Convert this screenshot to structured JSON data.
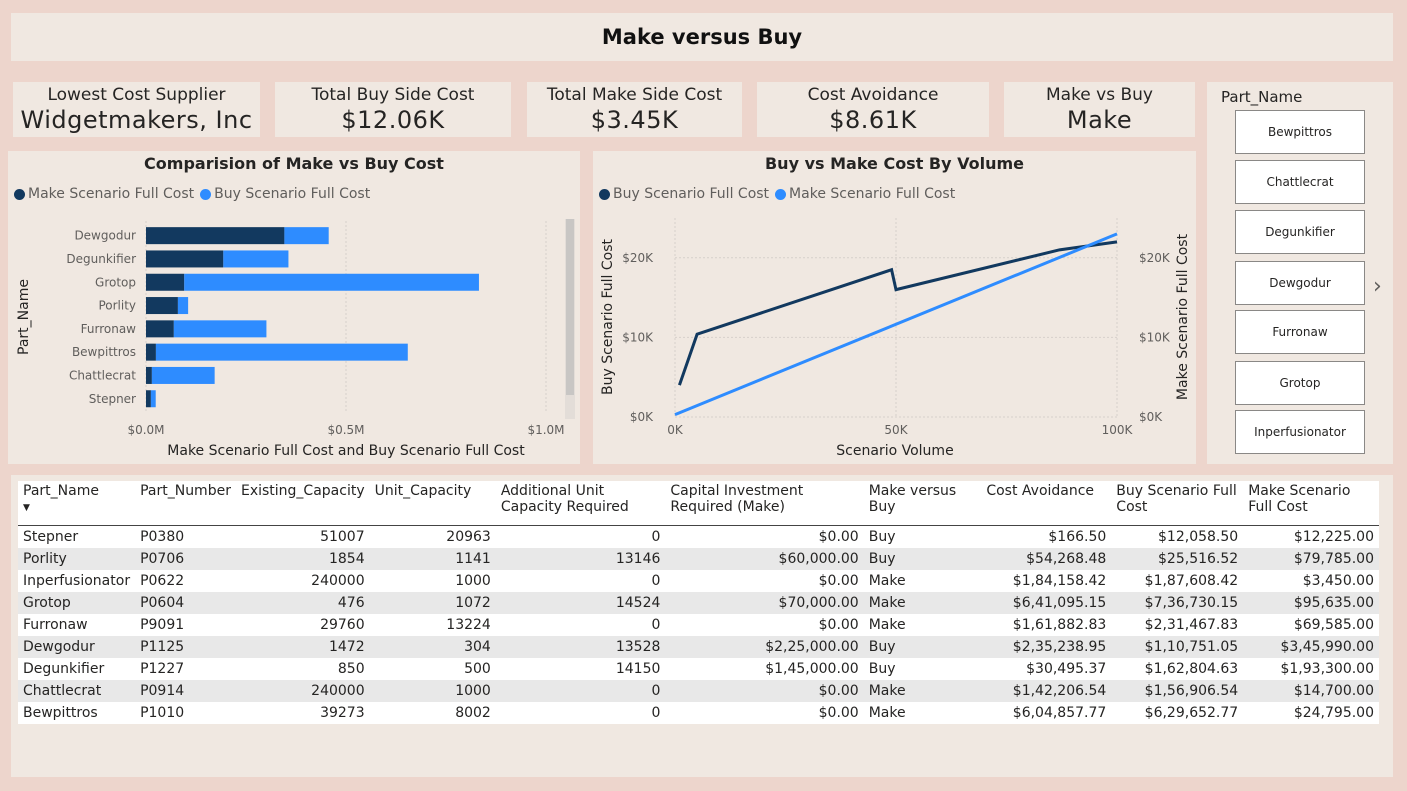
{
  "title": "Make versus Buy",
  "cards": [
    {
      "label": "Lowest Cost Supplier",
      "value": "Widgetmakers, Inc"
    },
    {
      "label": "Total Buy Side Cost",
      "value": "$12.06K"
    },
    {
      "label": "Total Make Side Cost",
      "value": "$3.45K"
    },
    {
      "label": "Cost Avoidance",
      "value": "$8.61K"
    },
    {
      "label": "Make vs Buy",
      "value": "Make"
    }
  ],
  "colors": {
    "make_dark": "#12395F",
    "buy_light": "#2E8CFF",
    "panel": "#F0E8E1",
    "background": "#EDD5CC"
  },
  "chart_data": [
    {
      "type": "bar",
      "title": "Comparision of Make vs Buy Cost",
      "xlabel": "Make Scenario Full Cost and Buy Scenario Full Cost",
      "ylabel": "Part_Name",
      "legend": [
        "Make Scenario Full Cost",
        "Buy Scenario Full Cost"
      ],
      "legend_position": "top-left",
      "stacked": true,
      "categories": [
        "Dewgodur",
        "Degunkifier",
        "Grotop",
        "Porlity",
        "Furronaw",
        "Bewpittros",
        "Chattlecrat",
        "Stepner"
      ],
      "series": [
        {
          "name": "Make Scenario Full Cost",
          "values": [
            345990,
            193300,
            95635,
            79785,
            69585,
            24795,
            14700,
            12225
          ]
        },
        {
          "name": "Buy Scenario Full Cost",
          "values": [
            110751,
            162805,
            736730,
            25517,
            231468,
            629653,
            156907,
            12059
          ]
        }
      ],
      "xlim": [
        0,
        1000000
      ],
      "xticks": [
        "$0.0M",
        "$0.5M",
        "$1.0M"
      ],
      "grid": true
    },
    {
      "type": "line",
      "title": "Buy vs Make Cost By Volume",
      "xlabel": "Scenario Volume",
      "ylabel": "Buy Scenario Full Cost",
      "ylabel_right": "Make Scenario Full Cost",
      "legend": [
        "Buy Scenario Full Cost",
        "Make Scenario Full Cost"
      ],
      "legend_position": "top-left",
      "xticks": [
        "0K",
        "50K",
        "100K"
      ],
      "yticks": [
        "$0K",
        "$10K",
        "$20K"
      ],
      "xlim": [
        0,
        100000
      ],
      "ylim": [
        0,
        25000
      ],
      "grid": true,
      "series": [
        {
          "name": "Buy Scenario Full Cost",
          "x": [
            1000,
            5000,
            49000,
            50000,
            87000,
            100000
          ],
          "y": [
            4000,
            10400,
            18500,
            16000,
            21000,
            22000
          ]
        },
        {
          "name": "Make Scenario Full Cost",
          "x": [
            0,
            100000
          ],
          "y": [
            300,
            23000
          ]
        }
      ]
    }
  ],
  "slicer": {
    "title": "Part_Name",
    "items": [
      "Bewpittros",
      "Chattlecrat",
      "Degunkifier",
      "Dewgodur",
      "Furronaw",
      "Grotop",
      "Inperfusionator"
    ]
  },
  "table": {
    "columns": [
      "Part_Name",
      "Part_Number",
      "Existing_Capacity",
      "Unit_Capacity",
      "Additional Unit Capacity Required",
      "Capital Investment Required (Make)",
      "Make versus Buy",
      "Cost Avoidance",
      "Buy Scenario Full Cost",
      "Make Scenario Full Cost"
    ],
    "rows": [
      [
        "Stepner",
        "P0380",
        "51007",
        "20963",
        "0",
        "$0.00",
        "Buy",
        "$166.50",
        "$12,058.50",
        "$12,225.00"
      ],
      [
        "Porlity",
        "P0706",
        "1854",
        "1141",
        "13146",
        "$60,000.00",
        "Buy",
        "$54,268.48",
        "$25,516.52",
        "$79,785.00"
      ],
      [
        "Inperfusionator",
        "P0622",
        "240000",
        "1000",
        "0",
        "$0.00",
        "Make",
        "$1,84,158.42",
        "$1,87,608.42",
        "$3,450.00"
      ],
      [
        "Grotop",
        "P0604",
        "476",
        "1072",
        "14524",
        "$70,000.00",
        "Make",
        "$6,41,095.15",
        "$7,36,730.15",
        "$95,635.00"
      ],
      [
        "Furronaw",
        "P9091",
        "29760",
        "13224",
        "0",
        "$0.00",
        "Make",
        "$1,61,882.83",
        "$2,31,467.83",
        "$69,585.00"
      ],
      [
        "Dewgodur",
        "P1125",
        "1472",
        "304",
        "13528",
        "$2,25,000.00",
        "Buy",
        "$2,35,238.95",
        "$1,10,751.05",
        "$3,45,990.00"
      ],
      [
        "Degunkifier",
        "P1227",
        "850",
        "500",
        "14150",
        "$1,45,000.00",
        "Buy",
        "$30,495.37",
        "$1,62,804.63",
        "$1,93,300.00"
      ],
      [
        "Chattlecrat",
        "P0914",
        "240000",
        "1000",
        "0",
        "$0.00",
        "Make",
        "$1,42,206.54",
        "$1,56,906.54",
        "$14,700.00"
      ],
      [
        "Bewpittros",
        "P1010",
        "39273",
        "8002",
        "0",
        "$0.00",
        "Make",
        "$6,04,857.77",
        "$6,29,652.77",
        "$24,795.00"
      ]
    ]
  }
}
